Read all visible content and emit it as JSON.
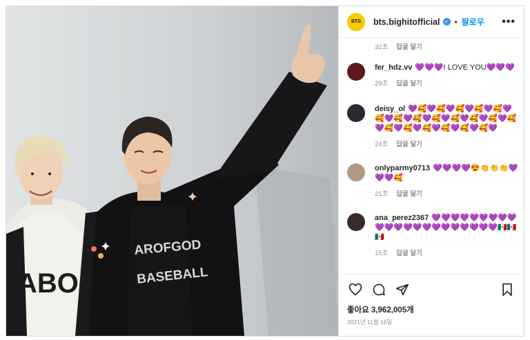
{
  "post": {
    "account": {
      "avatar_text": "BTS",
      "username": "bts.bighitofficial",
      "separator": "•",
      "follow_label": "팔로우",
      "more_label": "•••"
    },
    "top_meta": {
      "time": "32초",
      "reply": "답글 달기"
    },
    "comments": [
      {
        "user": "fer_hdz.vv",
        "text": "💜💜💜I LOVE YOU💜💜💜",
        "time": "29초",
        "reply": "답글 달기",
        "avatar_color": "#5a1a1a"
      },
      {
        "user": "deisy_ol",
        "text": "💜🥰💜🥰💜🥰💜🥰💜🥰💜🥰💜🥰💜🥰💜🥰💜🥰💜🥰💜🥰💜🥰💜🥰💜🥰💜🥰💜🥰💜🥰💜🥰💜",
        "time": "24초",
        "reply": "답글 달기",
        "avatar_color": "#2a2a33"
      },
      {
        "user": "onlyparmy0713",
        "text": "💜💜💜💜😍👏👏👏💜💜💜🥰",
        "time": "21초",
        "reply": "답글 달기",
        "avatar_color": "#b29a82"
      },
      {
        "user": "ana_perez2367",
        "text": "💜💜💜💜💜💜💜💜💜💜💜💜💜💜💜💜💜💜💜💜💜💜🇲🇽🇲🇽🇲🇽",
        "time": "15초",
        "reply": "답글 달기",
        "avatar_color": "#3a2a28"
      }
    ],
    "likes": "좋아요 3,962,005개",
    "date": "2021년 11월 16일"
  }
}
